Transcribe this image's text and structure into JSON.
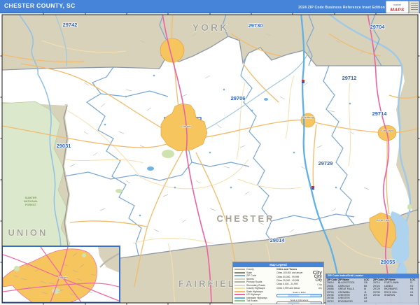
{
  "header": {
    "title": "CHESTER COUNTY, SC",
    "edition": "2024 ZIP Code Business Reference Inset Edition",
    "logo": {
      "brand_top": "market",
      "brand_main": "MAPS"
    }
  },
  "map": {
    "county_labels": {
      "north": "YORK",
      "west": "UNION",
      "center": "CHESTER",
      "south": "FAIRFIELD"
    },
    "zip_labels": [
      "29742",
      "29730",
      "29704",
      "29712",
      "29706",
      "29714",
      "29729",
      "29031",
      "29014",
      "29055"
    ],
    "forest_label": {
      "line1": "SUMTER",
      "line2": "NATIONAL",
      "line3": "FOREST"
    },
    "city_labels": {
      "chester": "Chester",
      "richburg": "Richburg",
      "fort_lawn": "Fort Lawn",
      "great_falls": "Great Falls"
    }
  },
  "legend": {
    "title": "Map Legend",
    "line_items": [
      {
        "label": "County",
        "color": "#b3b0a4"
      },
      {
        "label": "State",
        "color": "#8a887c"
      },
      {
        "label": "ZIP Code",
        "color": "#7aa6d2"
      },
      {
        "label": "Streets",
        "color": "#d2cfc6"
      },
      {
        "label": "Primary Roads",
        "color": "#b5b2a8"
      },
      {
        "label": "Secondary Roads",
        "color": "#d8d5cc"
      },
      {
        "label": "County Highways",
        "color": "#f6df9e"
      },
      {
        "label": "State Highways",
        "color": "#f2bb6a"
      },
      {
        "label": "US Highways",
        "color": "#e863a5"
      },
      {
        "label": "Interstate Highways",
        "color": "#5fb0e5"
      },
      {
        "label": "Toll Roads",
        "color": "#8fc98f"
      }
    ],
    "cities_header": "Cities and Towns",
    "city_sizes": [
      {
        "label": "Cities 100,000 and above",
        "sample": "City"
      },
      {
        "label": "Cities 50,000 - 99,999",
        "sample": "City"
      },
      {
        "label": "Cities 25,000 - 49,999",
        "sample": "City"
      },
      {
        "label": "Cities 5,000 - 24,999",
        "sample": "City"
      },
      {
        "label": "Cities 4,999 and below",
        "sample": "city"
      }
    ],
    "scale_label_top": "Scale in Miles",
    "scale_label_bottom": "Scale in Kilometers"
  },
  "zip_table": {
    "title": "ZIP Code Index/Grid Locator",
    "columns": [
      "ZIP Code",
      "ZIP Name",
      "LOC"
    ],
    "rows_left": [
      {
        "zip": "29014",
        "name": "BLACKSTOCK",
        "loc": "G6"
      },
      {
        "zip": "29031",
        "name": "CARLISLE",
        "loc": "B5"
      },
      {
        "zip": "29055",
        "name": "GREAT FALLS",
        "loc": "I6"
      },
      {
        "zip": "29704",
        "name": "CATAWBA",
        "loc": "J1"
      },
      {
        "zip": "29706",
        "name": "CHESTER",
        "loc": "B7"
      },
      {
        "zip": "29706",
        "name": "CHESTER",
        "loc": "D4"
      },
      {
        "zip": "29712",
        "name": "EDGEMOOR",
        "loc": "H2"
      }
    ],
    "rows_right": [
      {
        "zip": "29714",
        "name": "FORT LAWN",
        "loc": "I3"
      },
      {
        "zip": "29724",
        "name": "LANDO",
        "loc": "H2"
      },
      {
        "zip": "29729",
        "name": "RICHBURG",
        "loc": "H4"
      },
      {
        "zip": "29730",
        "name": "ROCK HILL",
        "loc": "H1"
      },
      {
        "zip": "29742",
        "name": "SHARON",
        "loc": "B1"
      }
    ]
  },
  "colors": {
    "header_bg": "#4584d8",
    "out_county": "#d9d2ba",
    "zip_label": "#2f62b8",
    "county_label": "#a5a398",
    "city_fill": "#f6c55e",
    "us_highway": "#e863a5",
    "interstate": "#5fb0e5",
    "road": "#f2bb6a",
    "zip_boundary": "#7aa6d2",
    "water": "#9ec9e8",
    "forest": "#dce8cb"
  }
}
